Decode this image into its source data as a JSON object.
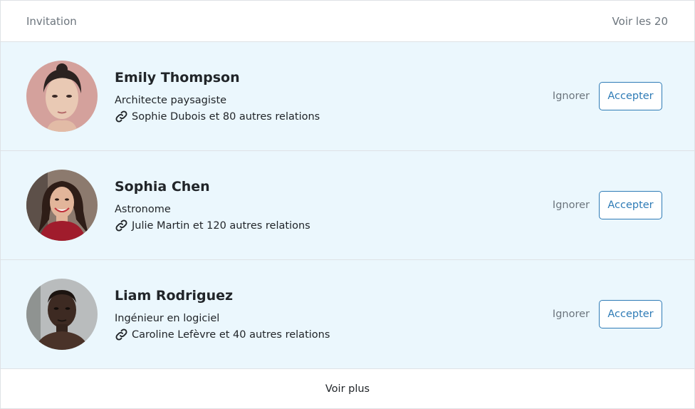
{
  "header": {
    "title": "Invitation",
    "see_all": "Voir les 20"
  },
  "invitations": [
    {
      "name": "Emily Thompson",
      "title": "Architecte paysagiste",
      "mutual": "Sophie Dubois et 80 autres relations",
      "ignore_label": "Ignorer",
      "accept_label": "Accepter",
      "avatar_bg": "#d4a19c"
    },
    {
      "name": "Sophia Chen",
      "title": "Astronome",
      "mutual": "Julie Martin et 120 autres relations",
      "ignore_label": "Ignorer",
      "accept_label": "Accepter",
      "avatar_bg": "#8c7a6e"
    },
    {
      "name": "Liam Rodriguez",
      "title": "Ingénieur en logiciel",
      "mutual": "Caroline Lefèvre et 40 autres relations",
      "ignore_label": "Ignorer",
      "accept_label": "Accepter",
      "avatar_bg": "#b9bcbd"
    }
  ],
  "footer": {
    "see_more": "Voir plus"
  },
  "colors": {
    "row_bg": "#ebf7fd",
    "accent": "#2e7bb6",
    "muted": "#6c757d",
    "border": "#dee2e6"
  },
  "icons": {
    "mutual": "link-icon"
  }
}
